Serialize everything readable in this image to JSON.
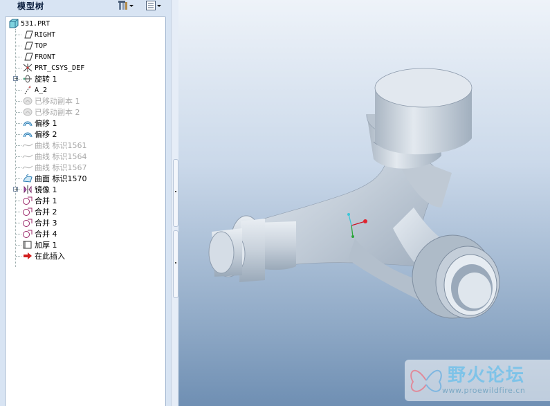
{
  "panel": {
    "title": "模型树"
  },
  "tree": {
    "root": "531.PRT",
    "items": [
      {
        "label": "RIGHT",
        "icon": "datum-plane-icon",
        "dim": false
      },
      {
        "label": "TOP",
        "icon": "datum-plane-icon",
        "dim": false
      },
      {
        "label": "FRONT",
        "icon": "datum-plane-icon",
        "dim": false
      },
      {
        "label": "PRT_CSYS_DEF",
        "icon": "coordinate-system-icon",
        "dim": false
      },
      {
        "label": "旋转 1",
        "icon": "revolve-icon",
        "dim": false,
        "expandable": true
      },
      {
        "label": "A_2",
        "icon": "datum-axis-icon",
        "dim": false
      },
      {
        "label": "已移动副本 1",
        "icon": "moved-copy-icon",
        "dim": true
      },
      {
        "label": "已移动副本 2",
        "icon": "moved-copy-icon",
        "dim": true
      },
      {
        "label": "偏移 1",
        "icon": "offset-icon",
        "dim": false
      },
      {
        "label": "偏移 2",
        "icon": "offset-icon",
        "dim": false
      },
      {
        "label": "曲线 标识1561",
        "icon": "curve-icon",
        "dim": true
      },
      {
        "label": "曲线 标识1564",
        "icon": "curve-icon",
        "dim": true
      },
      {
        "label": "曲线 标识1567",
        "icon": "curve-icon",
        "dim": true
      },
      {
        "label": "曲面 标识1570",
        "icon": "surface-icon",
        "dim": false
      },
      {
        "label": "镜像 1",
        "icon": "mirror-icon",
        "dim": false,
        "expandable": true
      },
      {
        "label": "合并 1",
        "icon": "merge-icon",
        "dim": false
      },
      {
        "label": "合并 2",
        "icon": "merge-icon",
        "dim": false
      },
      {
        "label": "合并 3",
        "icon": "merge-icon",
        "dim": false
      },
      {
        "label": "合并 4",
        "icon": "merge-icon",
        "dim": false
      },
      {
        "label": "加厚 1",
        "icon": "thicken-icon",
        "dim": false
      },
      {
        "label": "在此插入",
        "icon": "insert-here-arrow-icon",
        "dim": false
      }
    ]
  },
  "watermark": {
    "title": "野火论坛",
    "url": "www.proewildfire.cn"
  },
  "colors": {
    "accent": "#7ec3e8",
    "part": "#c9d3dd"
  }
}
